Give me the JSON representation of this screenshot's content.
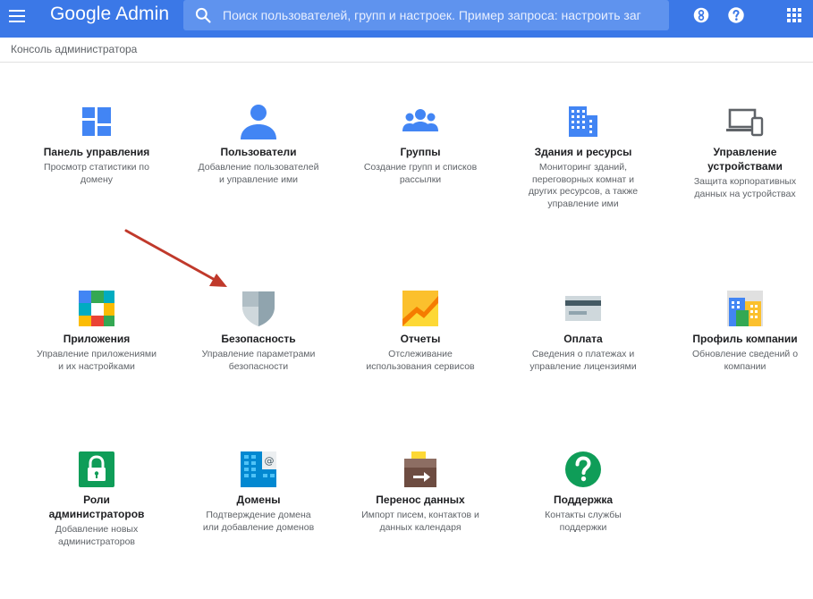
{
  "header": {
    "logo": "Google Admin",
    "search_placeholder": "Поиск пользователей, групп и настроек. Пример запроса: настроить заг"
  },
  "breadcrumb": "Консоль администратора",
  "colors": {
    "topbar": "#3b78e7",
    "accent": "#4285f4",
    "arrow": "#c0392b"
  },
  "tiles": [
    {
      "title": "Панель управления",
      "desc": "Просмотр статистики по домену",
      "icon": "dashboard-icon"
    },
    {
      "title": "Пользователи",
      "desc": "Добавление пользователей и управление ими",
      "icon": "user-icon"
    },
    {
      "title": "Группы",
      "desc": "Создание групп и списков рассылки",
      "icon": "groups-icon"
    },
    {
      "title": "Здания и ресурсы",
      "desc": "Мониторинг зданий, переговорных комнат и других ресурсов, а также управление ими",
      "icon": "building-icon"
    },
    {
      "title": "Управление устройствами",
      "desc": "Защита корпоративных данных на устройствах",
      "icon": "devices-icon"
    },
    {
      "title": "Приложения",
      "desc": "Управление приложениями и их настройками",
      "icon": "apps-icon"
    },
    {
      "title": "Безопасность",
      "desc": "Управление параметрами безопасности",
      "icon": "shield-icon"
    },
    {
      "title": "Отчеты",
      "desc": "Отслеживание использования сервисов",
      "icon": "reports-icon"
    },
    {
      "title": "Оплата",
      "desc": "Сведения о платежах и управление лицензиями",
      "icon": "credit-card-icon"
    },
    {
      "title": "Профиль компании",
      "desc": "Обновление сведений о компании",
      "icon": "company-profile-icon"
    },
    {
      "title": "Роли администраторов",
      "desc": "Добавление новых администраторов",
      "icon": "lock-icon"
    },
    {
      "title": "Домены",
      "desc": "Подтверждение домена или добавление доменов",
      "icon": "domains-icon"
    },
    {
      "title": "Перенос данных",
      "desc": "Импорт писем, контактов и данных календаря",
      "icon": "data-migration-icon"
    },
    {
      "title": "Поддержка",
      "desc": "Контакты службы поддержки",
      "icon": "help-icon"
    }
  ]
}
